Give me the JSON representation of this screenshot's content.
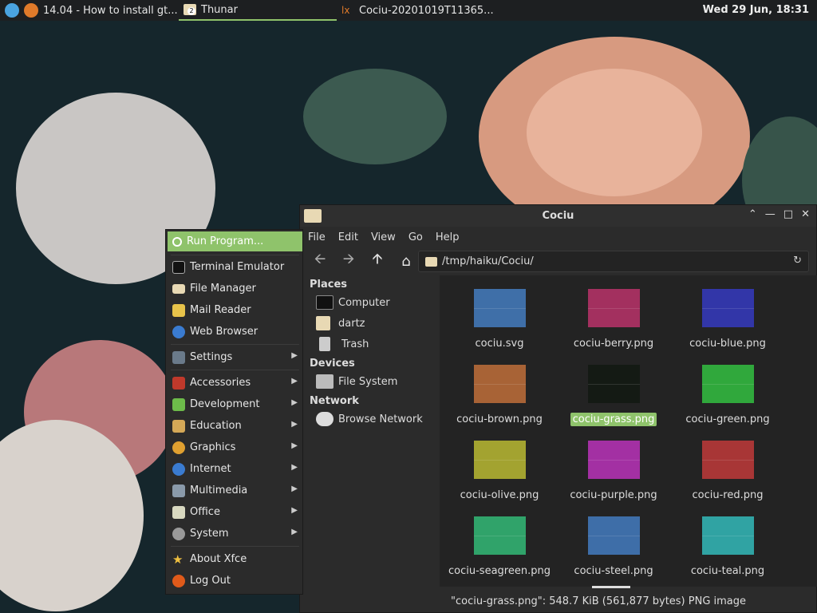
{
  "panel": {
    "tasks": [
      {
        "label": "14.04 - How to install gt...",
        "icon": "firefox-icon"
      },
      {
        "label": "Thunar",
        "icon": "folder-icon",
        "badge": "2",
        "active": true
      },
      {
        "label": "Cociu-20201019T11365...",
        "icon": "image-viewer-icon"
      }
    ],
    "clock": "Wed 29 Jun, 18:31"
  },
  "window": {
    "title": "Cociu",
    "menu": [
      "File",
      "Edit",
      "View",
      "Go",
      "Help"
    ],
    "location": "/tmp/haiku/Cociu/",
    "sidebar": {
      "places_title": "Places",
      "places": [
        "Computer",
        "dartz",
        "Trash"
      ],
      "devices_title": "Devices",
      "devices": [
        "File System"
      ],
      "network_title": "Network",
      "network": [
        "Browse Network"
      ]
    },
    "files": [
      {
        "name": "cociu.svg",
        "color": "#3f6fa8"
      },
      {
        "name": "cociu-berry.png",
        "color": "#a3305f"
      },
      {
        "name": "cociu-blue.png",
        "color": "#3236a8"
      },
      {
        "name": "cociu-brown.png",
        "color": "#a86336"
      },
      {
        "name": "cociu-grass.png",
        "color": "#141a14",
        "selected": true
      },
      {
        "name": "cociu-green.png",
        "color": "#30a83c"
      },
      {
        "name": "cociu-olive.png",
        "color": "#a3a330"
      },
      {
        "name": "cociu-purple.png",
        "color": "#a330a3"
      },
      {
        "name": "cociu-red.png",
        "color": "#a83636"
      },
      {
        "name": "cociu-seagreen.png",
        "color": "#30a36a"
      },
      {
        "name": "cociu-steel.png",
        "color": "#3e6ea8"
      },
      {
        "name": "cociu-teal.png",
        "color": "#30a3a3"
      }
    ],
    "status": "\"cociu-grass.png\": 548.7 KiB (561,877 bytes) PNG image",
    "accent": "#8fc36b"
  },
  "appmenu": {
    "items": [
      {
        "label": "Run Program...",
        "icon": "search-icon",
        "highlight": true
      },
      {
        "label": "Terminal Emulator",
        "icon": "terminal-icon"
      },
      {
        "label": "File Manager",
        "icon": "folder-icon"
      },
      {
        "label": "Mail Reader",
        "icon": "mail-icon"
      },
      {
        "label": "Web Browser",
        "icon": "globe-icon"
      },
      {
        "label": "Settings",
        "icon": "settings-icon",
        "submenu": true
      },
      {
        "label": "Accessories",
        "icon": "accessories-icon",
        "submenu": true
      },
      {
        "label": "Development",
        "icon": "development-icon",
        "submenu": true
      },
      {
        "label": "Education",
        "icon": "education-icon",
        "submenu": true
      },
      {
        "label": "Graphics",
        "icon": "graphics-icon",
        "submenu": true
      },
      {
        "label": "Internet",
        "icon": "internet-icon",
        "submenu": true
      },
      {
        "label": "Multimedia",
        "icon": "multimedia-icon",
        "submenu": true
      },
      {
        "label": "Office",
        "icon": "office-icon",
        "submenu": true
      },
      {
        "label": "System",
        "icon": "system-icon",
        "submenu": true
      },
      {
        "label": "About Xfce",
        "icon": "star-icon"
      },
      {
        "label": "Log Out",
        "icon": "logout-icon"
      }
    ]
  }
}
